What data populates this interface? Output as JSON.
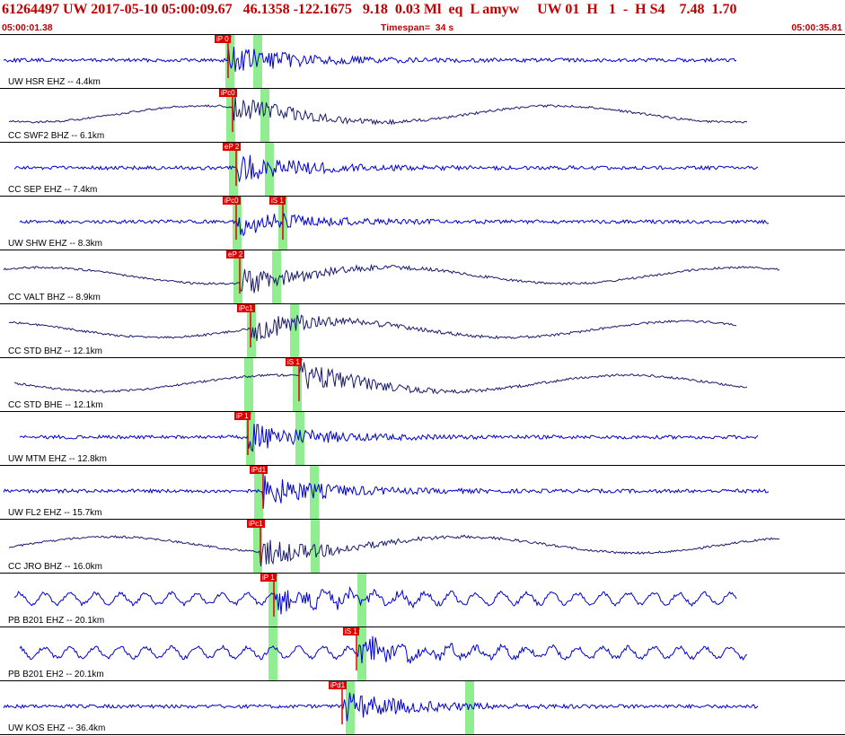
{
  "header": {
    "title": "61264497 UW 2017-05-10 05:00:09.67   46.1358 -122.1675   9.18  0.03 Ml  eq  L amyw     UW 01  H   1  -  H S4    7.48  1.70",
    "time_start": "05:00:01.38",
    "timespan": "Timespan=  34 s",
    "time_end": "05:00:35.81"
  },
  "colors": {
    "header_text": "#c00000",
    "trace_primary": "#0000d0",
    "trace_dark": "#1a1a6e",
    "pick": "#e00000",
    "window": "#90ee90"
  },
  "icons": {
    "pick_flag": "pick-flag-icon",
    "pick_marker": "triangle-down-icon"
  },
  "stations": [
    {
      "label": "UW HSR EHZ -- 4.4km",
      "color": "primary",
      "picks": [
        {
          "label": "iP 0",
          "pos": 0.27
        }
      ],
      "windows": [
        0.272,
        0.305
      ]
    },
    {
      "label": "CC SWF2 BHZ -- 6.1km",
      "color": "dark",
      "picks": [
        {
          "label": "iPc0",
          "pos": 0.275
        }
      ],
      "windows": [
        0.273,
        0.313
      ]
    },
    {
      "label": "CC SEP EHZ -- 7.4km",
      "color": "primary",
      "picks": [
        {
          "label": "eP 2",
          "pos": 0.279
        }
      ],
      "windows": [
        0.276,
        0.319
      ]
    },
    {
      "label": "UW SHW EHZ -- 8.3km",
      "color": "primary",
      "picks": [
        {
          "label": "iPc0",
          "pos": 0.279
        },
        {
          "label": "iS 1",
          "pos": 0.335
        }
      ],
      "windows": [
        0.281,
        0.335
      ]
    },
    {
      "label": "CC VALT BHZ -- 8.9km",
      "color": "dark",
      "picks": [
        {
          "label": "eP 2",
          "pos": 0.284
        }
      ],
      "windows": [
        0.282,
        0.327
      ]
    },
    {
      "label": "CC STD BHZ -- 12.1km",
      "color": "dark",
      "picks": [
        {
          "label": "iPc1",
          "pos": 0.297
        }
      ],
      "windows": [
        0.298,
        0.349
      ]
    },
    {
      "label": "CC STD BHE -- 12.1km",
      "color": "dark",
      "picks": [
        {
          "label": "iS 1",
          "pos": 0.354
        }
      ],
      "windows": [
        0.294,
        0.352
      ]
    },
    {
      "label": "UW MTM EHZ -- 12.8km",
      "color": "primary",
      "picks": [
        {
          "label": "iP 1",
          "pos": 0.293
        }
      ],
      "windows": [
        0.297,
        0.355
      ]
    },
    {
      "label": "UW FL2 EHZ -- 15.7km",
      "color": "primary",
      "picks": [
        {
          "label": "iPd1",
          "pos": 0.311
        }
      ],
      "windows": [
        0.306,
        0.372
      ]
    },
    {
      "label": "CC JRO BHZ -- 16.0km",
      "color": "dark",
      "picks": [
        {
          "label": "iPc1",
          "pos": 0.308
        }
      ],
      "windows": [
        0.305,
        0.373
      ]
    },
    {
      "label": "PB B201 EHZ -- 20.1km",
      "color": "primary",
      "picks": [
        {
          "label": "iP 1",
          "pos": 0.324
        }
      ],
      "windows": [
        0.323,
        0.428
      ]
    },
    {
      "label": "PB B201 EH2 -- 20.1km",
      "color": "primary",
      "picks": [
        {
          "label": "iS 1",
          "pos": 0.422
        }
      ],
      "windows": [
        0.323,
        0.428
      ]
    },
    {
      "label": "UW KOS EHZ -- 36.4km",
      "color": "primary",
      "picks": [
        {
          "label": "iPd1",
          "pos": 0.405
        }
      ],
      "windows": [
        0.414,
        0.556
      ]
    }
  ]
}
